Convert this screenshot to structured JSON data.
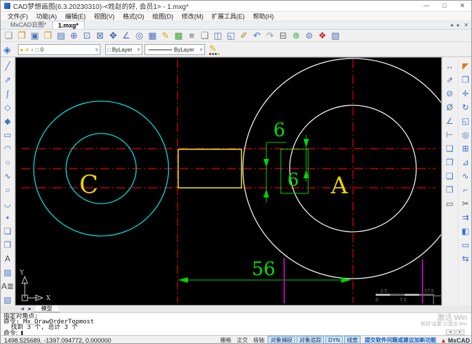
{
  "window": {
    "title": "CAD梦想画图(6.3.20230310)-<姓赵的好, 会员1> - 1.mxg*",
    "controls": [
      {
        "name": "minimize",
        "glyph": "—"
      },
      {
        "name": "maximize",
        "glyph": "□"
      },
      {
        "name": "close",
        "glyph": "✕"
      }
    ]
  },
  "menu": {
    "items": [
      {
        "label": "文件(F)"
      },
      {
        "label": "功能(A)"
      },
      {
        "label": "编辑(E)"
      },
      {
        "label": "视图(V)"
      },
      {
        "label": "格式(O)"
      },
      {
        "label": "绘图(D)"
      },
      {
        "label": "修改(M)"
      },
      {
        "label": "扩展工具(E)"
      },
      {
        "label": "帮助(H)"
      }
    ]
  },
  "tabs": {
    "items": [
      {
        "label": "MxCAD云图*",
        "active": false
      },
      {
        "label": "1.mxg*",
        "active": true
      }
    ],
    "controls": [
      {
        "name": "scroll-left",
        "glyph": "◂"
      },
      {
        "name": "scroll-right",
        "glyph": "▸"
      },
      {
        "name": "close-tab",
        "glyph": "✕"
      }
    ]
  },
  "toolbar_main": {
    "icons": [
      {
        "name": "new-file",
        "glyph": "❏",
        "color": "#8a8a8a"
      },
      {
        "name": "open-drawing",
        "glyph": "❐",
        "color": "#c98a1b"
      },
      {
        "name": "save",
        "glyph": "▣",
        "color": "#4a72b8"
      },
      {
        "name": "open-folder",
        "glyph": "❒",
        "color": "#c98a1b"
      },
      {
        "name": "save-as",
        "glyph": "▤",
        "color": "#4a72b8"
      },
      {
        "name": "zoom-in",
        "glyph": "⊕",
        "color": "#4a72b8"
      },
      {
        "name": "zoom-window",
        "glyph": "⊡",
        "color": "#4a72b8"
      },
      {
        "name": "zoom-extents",
        "glyph": "⊠",
        "color": "#4a72b8"
      },
      {
        "name": "pan",
        "glyph": "✥",
        "color": "#3a5da8"
      },
      {
        "name": "measure",
        "glyph": "∠",
        "color": "#4a72b8"
      },
      {
        "name": "zoom-object",
        "glyph": "◎",
        "color": "#4a72b8"
      },
      {
        "name": "layer-manager",
        "glyph": "▦",
        "color": "#4a72b8"
      },
      {
        "name": "draw-tool",
        "glyph": "✎",
        "color": "#d8a800"
      },
      {
        "name": "color-palette",
        "glyph": "▩",
        "color": "#3fa33f"
      },
      {
        "name": "linetype-list",
        "glyph": "≡",
        "color": "#555555"
      },
      {
        "name": "block-library",
        "glyph": "❑",
        "color": "#777777"
      },
      {
        "name": "layout-settings",
        "glyph": "◫",
        "color": "#4a72b8"
      },
      {
        "name": "selection",
        "glyph": "◱",
        "color": "#4a72b8"
      },
      {
        "name": "edit-attributes",
        "glyph": "✐",
        "color": "#b08830"
      },
      {
        "name": "undo",
        "glyph": "↶",
        "color": "#3a6fd8"
      },
      {
        "name": "redo",
        "glyph": "↷",
        "color": "#9a9a9a"
      },
      {
        "name": "print",
        "glyph": "⊟",
        "color": "#666666"
      },
      {
        "name": "publish-web",
        "glyph": "⊛",
        "color": "#3fa33f"
      },
      {
        "name": "web-share",
        "glyph": "⊜",
        "color": "#4a72b8"
      },
      {
        "name": "export-pdf",
        "glyph": "❖",
        "color": "#cc2222"
      },
      {
        "name": "insert-image",
        "glyph": "▨",
        "color": "#4a72b8"
      }
    ]
  },
  "layer_bar": {
    "stack_icon_glyph": "◈",
    "indicators": [
      {
        "name": "layer-bulb",
        "glyph": "●",
        "color": "#d8b400"
      },
      {
        "name": "layer-sun",
        "glyph": "☀",
        "color": "#d8b400"
      },
      {
        "name": "layer-lock",
        "glyph": "◐",
        "color": "#999999"
      },
      {
        "name": "layer-color-swatch",
        "glyph": "□",
        "color": "#555555"
      }
    ],
    "layer_value": "0",
    "color_value": "ByLayer",
    "color_swatch_glyph": "□",
    "linetype_value": "ByLayer",
    "dropdown_glyph": "∨",
    "pencil_glyph": "✎",
    "pencil_dot_colors": [
      "#e03030",
      "#30a030",
      "#3060e0",
      "#e0c020"
    ]
  },
  "toolbar_draw": {
    "icons": [
      {
        "name": "line",
        "glyph": "╱",
        "color": "#4a72b8"
      },
      {
        "name": "construction-line",
        "glyph": "⇗",
        "color": "#4a72b8"
      },
      {
        "name": "polyline",
        "glyph": "ʃ",
        "color": "#4a72b8"
      },
      {
        "name": "polygon",
        "glyph": "◇",
        "color": "#4a72b8"
      },
      {
        "name": "polygon-inscribed",
        "glyph": "◆",
        "color": "#4a72b8"
      },
      {
        "name": "rectangle",
        "glyph": "▭",
        "color": "#4a72b8"
      },
      {
        "name": "arc",
        "glyph": "◠",
        "color": "#4a72b8"
      },
      {
        "name": "circle",
        "glyph": "○",
        "color": "#4a72b8"
      },
      {
        "name": "spline",
        "glyph": "∿",
        "color": "#4a72b8"
      },
      {
        "name": "ellipse",
        "glyph": "○",
        "color": "#4a72b8"
      },
      {
        "name": "ellipse-arc",
        "glyph": "◡",
        "color": "#4a72b8"
      },
      {
        "name": "point",
        "glyph": "▪",
        "color": "#4a72b8"
      },
      {
        "name": "block-create",
        "glyph": "❏",
        "color": "#4a72b8"
      },
      {
        "name": "block-insert",
        "glyph": "❐",
        "color": "#4a72b8"
      },
      {
        "name": "text",
        "glyph": "A",
        "color": "#444444"
      },
      {
        "name": "image",
        "glyph": "▨",
        "color": "#4a72b8"
      },
      {
        "name": "mtext",
        "glyph": "A≣",
        "color": "#444444"
      },
      {
        "name": "hatch",
        "glyph": "▧",
        "color": "#4a72b8"
      }
    ]
  },
  "toolbar_dimension": {
    "icons": [
      {
        "name": "dim-linear",
        "glyph": "↔",
        "color": "#4a72b8"
      },
      {
        "name": "dim-aligned",
        "glyph": "⇗",
        "color": "#4a72b8"
      },
      {
        "name": "dim-diameter",
        "glyph": "⊘",
        "color": "#4a72b8"
      },
      {
        "name": "dim-radius",
        "glyph": "Ø",
        "color": "#4a72b8"
      },
      {
        "name": "dim-angular",
        "glyph": "∠",
        "color": "#4a72b8"
      },
      {
        "name": "dim-baseline",
        "glyph": "⊢",
        "color": "#4a72b8"
      },
      {
        "name": "dim-style-1",
        "glyph": "❏",
        "color": "#3a6fd8"
      },
      {
        "name": "dim-style-2",
        "glyph": "❐",
        "color": "#3a6fd8"
      },
      {
        "name": "dim-style-3",
        "glyph": "❑",
        "color": "#3a6fd8"
      },
      {
        "name": "dim-style-4",
        "glyph": "❒",
        "color": "#3a6fd8"
      },
      {
        "name": "dim-edit",
        "glyph": "▭",
        "color": "#555555"
      }
    ]
  },
  "toolbar_modify": {
    "icons": [
      {
        "name": "erase",
        "glyph": "◤",
        "color": "#e07820"
      },
      {
        "name": "copy",
        "glyph": "❐",
        "color": "#3a6fd8"
      },
      {
        "name": "move",
        "glyph": "✛",
        "color": "#3a6fd8"
      },
      {
        "name": "rotate",
        "glyph": "↻",
        "color": "#3a6fd8"
      },
      {
        "name": "scale",
        "glyph": "◱",
        "color": "#3a6fd8"
      },
      {
        "name": "offset",
        "glyph": "◎",
        "color": "#3a6fd8"
      },
      {
        "name": "array",
        "glyph": "⊞",
        "color": "#3a6fd8"
      },
      {
        "name": "mirror",
        "glyph": "⊿",
        "color": "#3a6fd8"
      },
      {
        "name": "spline-edit",
        "glyph": "∿",
        "color": "#3a6fd8"
      },
      {
        "name": "chamfer",
        "glyph": "⌐",
        "color": "#3a6fd8"
      },
      {
        "name": "trim",
        "glyph": "✂",
        "color": "#555555"
      },
      {
        "name": "extend",
        "glyph": "⇉",
        "color": "#3a6fd8"
      },
      {
        "name": "explode",
        "glyph": "◧",
        "color": "#3a6fd8"
      },
      {
        "name": "pedit",
        "glyph": "▭",
        "color": "#3a6fd8"
      },
      {
        "name": "join",
        "glyph": "⇆",
        "color": "#3a6fd8"
      }
    ]
  },
  "canvas": {
    "labels": {
      "circle_left": "C",
      "circle_right": "A",
      "dim_top": "6",
      "dim_bottom": "6",
      "dim_width": "56",
      "ucs_x": "X",
      "ucs_y": "Y"
    },
    "ruler": {
      "top_left": "2.5",
      "top_right": "17.5",
      "bottom_left": "0",
      "bottom_right": "7.5"
    },
    "colors": {
      "centerline": "#e60000",
      "circle_small_pair": "#00e0e0",
      "circle_large_pair": "#f2f2f2",
      "slot": "#f0f000",
      "dimension": "#00d800",
      "label_text": "#edd000",
      "polyline_markers": "#f000f0"
    }
  },
  "model_strip": {
    "nav": [
      {
        "name": "prev-layout",
        "glyph": "◄"
      },
      {
        "name": "next-layout",
        "glyph": "►"
      }
    ],
    "tab_label": "模型"
  },
  "command": {
    "lines": [
      {
        "text": "指定对角点:"
      },
      {
        "text": "命令: Mx_DrawOrderTopmost"
      },
      {
        "text": "  找到 3 个, 总计 3 个"
      }
    ],
    "prompt": "命令:",
    "scroll": [
      {
        "name": "scroll-left",
        "glyph": "◂"
      },
      {
        "name": "scroll-right",
        "glyph": "▸"
      }
    ]
  },
  "watermark": {
    "line1": "激活 Win",
    "line2": "转到“设置”以激活 Win"
  },
  "status": {
    "coords": "1498.525689, -1397.094772,  0.000000",
    "toggles": [
      {
        "label": "栅格",
        "active": false
      },
      {
        "label": "正交",
        "active": false
      },
      {
        "label": "极轴",
        "active": false
      },
      {
        "label": "对象捕捉",
        "active": true
      },
      {
        "label": "对象追踪",
        "active": true
      },
      {
        "label": "DYN",
        "active": true
      },
      {
        "label": "线宽",
        "active": true
      }
    ],
    "feedback_link": "提交软件问题或建议加新功能",
    "brand": "MxCAD",
    "brand_logo_glyph": "▲"
  }
}
